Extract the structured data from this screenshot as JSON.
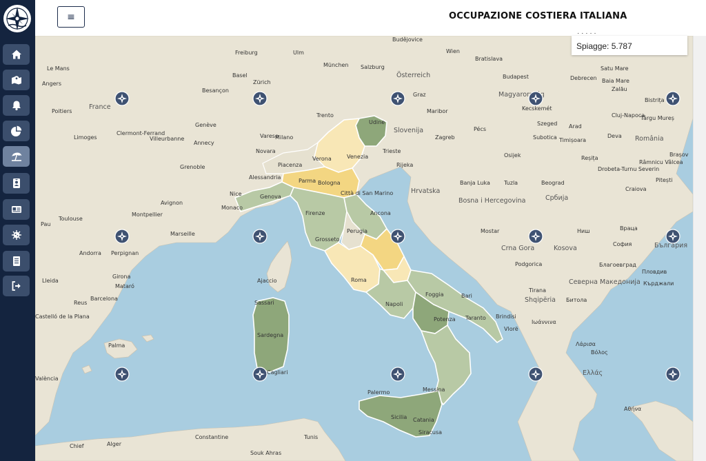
{
  "app": {
    "title": "OCCUPAZIONE COSTIERA ITALIANA"
  },
  "header": {
    "menu_icon": "hamburger-icon",
    "menu_glyph": "≡"
  },
  "sidebar": {
    "logo_icon": "compass-rose-logo",
    "items": [
      {
        "icon": "home-icon",
        "active": false
      },
      {
        "icon": "map-marker-icon",
        "active": false
      },
      {
        "icon": "bell-icon",
        "active": false
      },
      {
        "icon": "pie-chart-icon",
        "active": false
      },
      {
        "icon": "beach-umbrella-icon",
        "active": true
      },
      {
        "icon": "id-badge-icon",
        "active": false
      },
      {
        "icon": "id-card-icon",
        "active": false
      },
      {
        "icon": "virus-icon",
        "active": false
      },
      {
        "icon": "document-icon",
        "active": false
      },
      {
        "icon": "logout-icon",
        "active": false
      }
    ]
  },
  "info_box": {
    "clipped_text": "· · · · ·",
    "label": "Spiagge: 5.787"
  },
  "map": {
    "marker_icon": "compass-marker-icon",
    "colors": {
      "sea": "#a9cde0",
      "land": "#e9e4d5",
      "dark_green": "#8ea77a",
      "light_green": "#b8c9a5",
      "gold": "#f3d682",
      "light_gold": "#f8e7b6"
    },
    "regions": [
      {
        "name": "Friuli-Venezia Giulia",
        "level": "dark_green"
      },
      {
        "name": "Veneto",
        "level": "light_gold"
      },
      {
        "name": "Emilia-Romagna",
        "level": "gold"
      },
      {
        "name": "Liguria",
        "level": "light_green"
      },
      {
        "name": "Toscana",
        "level": "light_green"
      },
      {
        "name": "Marche",
        "level": "light_green"
      },
      {
        "name": "Lazio",
        "level": "light_gold"
      },
      {
        "name": "Abruzzo",
        "level": "gold"
      },
      {
        "name": "Molise",
        "level": "light_gold"
      },
      {
        "name": "Campania",
        "level": "light_green"
      },
      {
        "name": "Puglia",
        "level": "light_green"
      },
      {
        "name": "Basilicata",
        "level": "dark_green"
      },
      {
        "name": "Calabria",
        "level": "light_green"
      },
      {
        "name": "Sicilia",
        "level": "dark_green"
      },
      {
        "name": "Sardegna",
        "level": "dark_green"
      }
    ],
    "cities": [
      "Freiburg",
      "Ulm",
      "München",
      "Wien",
      "Bratislava",
      "Budějovice",
      "Zürich",
      "Basel",
      "Salzburg",
      "Österreich",
      "Budapest",
      "Magyarország",
      "Debrecen",
      "Satu Mare",
      "Baia Mare",
      "Zalău",
      "Bistrița",
      "Cluj-Napoca",
      "Târgu Mureș",
      "Szeged",
      "Kecskemét",
      "Arad",
      "Timișoara",
      "Deva",
      "România",
      "Brașov",
      "Reșița",
      "Drobeta-Turnu Severin",
      "Râmnicu Vâlcea",
      "Craiova",
      "Pitești",
      "Le Mans",
      "Angers",
      "France",
      "Poitiers",
      "Limoges",
      "Clermont-Ferrand",
      "Villeurbanne",
      "Annecy",
      "Grenoble",
      "Besançon",
      "Genève",
      "Milano",
      "Novara",
      "Varese",
      "Piacenza",
      "Alessandria",
      "Genova",
      "Parma",
      "Bologna",
      "Città di San Marino",
      "Firenze",
      "Grosseto",
      "Perugia",
      "Ancona",
      "Roma",
      "Napoli",
      "Bari",
      "Foggia",
      "Potenza",
      "Taranto",
      "Brindisi",
      "Udine",
      "Trieste",
      "Venezia",
      "Verona",
      "Trento",
      "Slovenija",
      "Zagreb",
      "Rijeka",
      "Maribor",
      "Graz",
      "Pécs",
      "Osijek",
      "Subotica",
      "Hrvatska",
      "Banja Luka",
      "Tuzla",
      "Beograd",
      "Србија",
      "Bosna i Hercegovina",
      "Mostar",
      "Crna Gora",
      "Podgorica",
      "Kosova",
      "Shqipëria",
      "Tirana",
      "Vlorë",
      "Северна Македонија",
      "Битола",
      "Ниш",
      "Враца",
      "София",
      "Пловдив",
      "Благоевград",
      "Кърджали",
      "България",
      "Ελλάς",
      "Λάρισα",
      "Βόλος",
      "Αθήνα",
      "Ιωάννινα",
      "Monaco",
      "Marseille",
      "Montpellier",
      "Toulouse",
      "Nice",
      "Avignon",
      "Andorra",
      "Perpignan",
      "Girona",
      "Barcelona",
      "Reus",
      "Lleida",
      "Mataró",
      "Castelló de la Plana",
      "València",
      "Palma",
      "Ajaccio",
      "Sassari",
      "Sardegna",
      "Cagliari",
      "Palermo",
      "Sicilia",
      "Catania",
      "Siracusa",
      "Messina",
      "Constantine",
      "Alger",
      "Chief",
      "Souk Ahras",
      "Tunis",
      "Pau"
    ]
  }
}
